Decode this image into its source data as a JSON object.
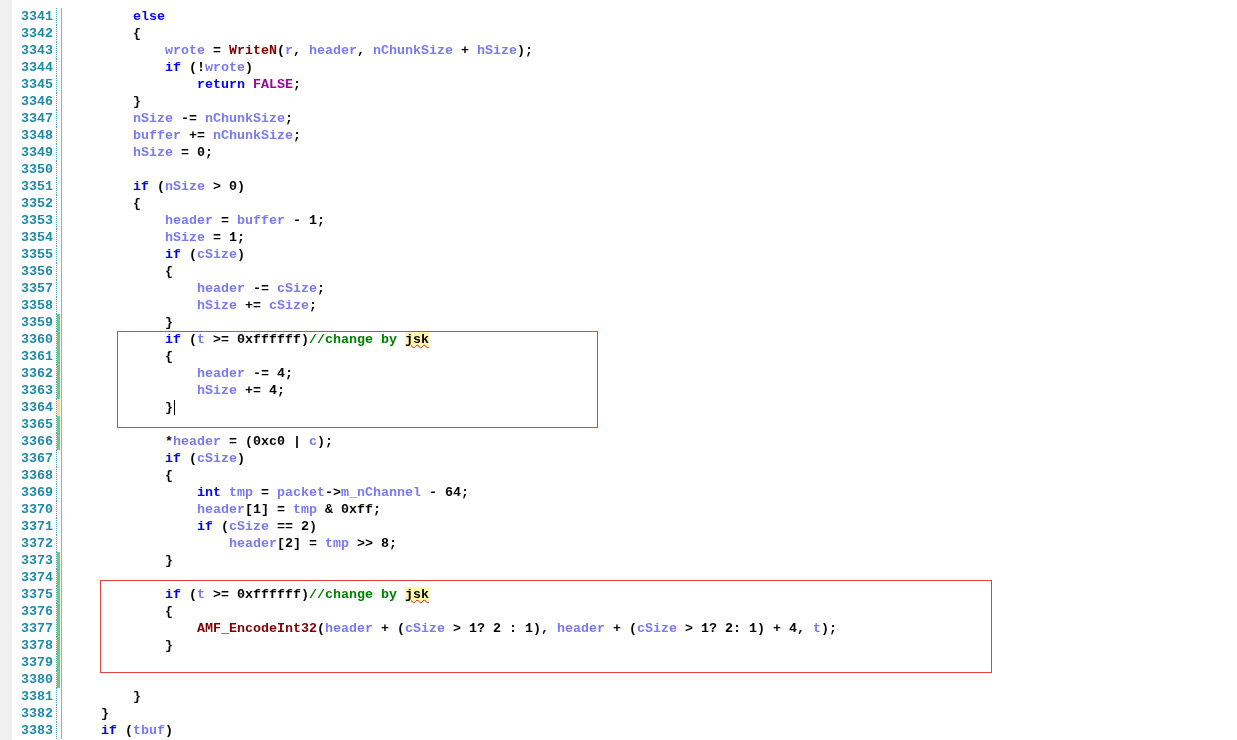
{
  "lines": [
    {
      "kind": "code",
      "number": "3341",
      "modified": false,
      "tokens": [
        {
          "kind": "keyword",
          "text": "        else"
        }
      ]
    },
    {
      "kind": "code",
      "number": "3342",
      "modified": false,
      "tokens": [
        {
          "kind": "plain",
          "text": "        {"
        }
      ]
    },
    {
      "kind": "code",
      "number": "3343",
      "modified": false,
      "tokens": [
        {
          "kind": "variable",
          "text": "            wrote"
        },
        {
          "kind": "plain",
          "text": " = "
        },
        {
          "kind": "function",
          "text": "WriteN"
        },
        {
          "kind": "plain",
          "text": "("
        },
        {
          "kind": "variable",
          "text": "r"
        },
        {
          "kind": "plain",
          "text": ", "
        },
        {
          "kind": "variable",
          "text": "header"
        },
        {
          "kind": "plain",
          "text": ", "
        },
        {
          "kind": "variable",
          "text": "nChunkSize"
        },
        {
          "kind": "plain",
          "text": " + "
        },
        {
          "kind": "variable",
          "text": "hSize"
        },
        {
          "kind": "plain",
          "text": ");"
        }
      ]
    },
    {
      "kind": "code",
      "number": "3344",
      "modified": false,
      "tokens": [
        {
          "kind": "keyword",
          "text": "            if"
        },
        {
          "kind": "plain",
          "text": " (!"
        },
        {
          "kind": "variable",
          "text": "wrote"
        },
        {
          "kind": "plain",
          "text": ")"
        }
      ]
    },
    {
      "kind": "code",
      "number": "3345",
      "modified": false,
      "tokens": [
        {
          "kind": "keyword",
          "text": "                return "
        },
        {
          "kind": "constant",
          "text": "FALSE"
        },
        {
          "kind": "plain",
          "text": ";"
        }
      ]
    },
    {
      "kind": "code",
      "number": "3346",
      "modified": false,
      "tokens": [
        {
          "kind": "plain",
          "text": "        }"
        }
      ]
    },
    {
      "kind": "code",
      "number": "3347",
      "modified": false,
      "tokens": [
        {
          "kind": "variable",
          "text": "        nSize"
        },
        {
          "kind": "plain",
          "text": " -= "
        },
        {
          "kind": "variable",
          "text": "nChunkSize"
        },
        {
          "kind": "plain",
          "text": ";"
        }
      ]
    },
    {
      "kind": "code",
      "number": "3348",
      "modified": false,
      "tokens": [
        {
          "kind": "variable",
          "text": "        buffer"
        },
        {
          "kind": "plain",
          "text": " += "
        },
        {
          "kind": "variable",
          "text": "nChunkSize"
        },
        {
          "kind": "plain",
          "text": ";"
        }
      ]
    },
    {
      "kind": "code",
      "number": "3349",
      "modified": false,
      "tokens": [
        {
          "kind": "variable",
          "text": "        hSize"
        },
        {
          "kind": "plain",
          "text": " = 0;"
        }
      ]
    },
    {
      "kind": "code",
      "number": "3350",
      "modified": false
    },
    {
      "kind": "code",
      "number": "3351",
      "modified": false,
      "tokens": [
        {
          "kind": "keyword",
          "text": "        if"
        },
        {
          "kind": "plain",
          "text": " ("
        },
        {
          "kind": "variable",
          "text": "nSize"
        },
        {
          "kind": "plain",
          "text": " > 0)"
        }
      ]
    },
    {
      "kind": "code",
      "number": "3352",
      "modified": false,
      "tokens": [
        {
          "kind": "plain",
          "text": "        {"
        }
      ]
    },
    {
      "kind": "code",
      "number": "3353",
      "modified": false,
      "tokens": [
        {
          "kind": "variable",
          "text": "            header"
        },
        {
          "kind": "plain",
          "text": " = "
        },
        {
          "kind": "variable",
          "text": "buffer"
        },
        {
          "kind": "plain",
          "text": " - 1;"
        }
      ]
    },
    {
      "kind": "code",
      "number": "3354",
      "modified": false,
      "tokens": [
        {
          "kind": "variable",
          "text": "            hSize"
        },
        {
          "kind": "plain",
          "text": " = 1;"
        }
      ]
    },
    {
      "kind": "code",
      "number": "3355",
      "modified": false,
      "tokens": [
        {
          "kind": "keyword",
          "text": "            if"
        },
        {
          "kind": "plain",
          "text": " ("
        },
        {
          "kind": "variable",
          "text": "cSize"
        },
        {
          "kind": "plain",
          "text": ")"
        }
      ]
    },
    {
      "kind": "code",
      "number": "3356",
      "modified": false,
      "tokens": [
        {
          "kind": "plain",
          "text": "            {"
        }
      ]
    },
    {
      "kind": "code",
      "number": "3357",
      "modified": false,
      "tokens": [
        {
          "kind": "variable",
          "text": "                header"
        },
        {
          "kind": "plain",
          "text": " -= "
        },
        {
          "kind": "variable",
          "text": "cSize"
        },
        {
          "kind": "plain",
          "text": ";"
        }
      ]
    },
    {
      "kind": "code",
      "number": "3358",
      "modified": false,
      "tokens": [
        {
          "kind": "variable",
          "text": "                hSize"
        },
        {
          "kind": "plain",
          "text": " += "
        },
        {
          "kind": "variable",
          "text": "cSize"
        },
        {
          "kind": "plain",
          "text": ";"
        }
      ]
    },
    {
      "kind": "code",
      "number": "3359",
      "modified": true,
      "saved": true,
      "tokens": [
        {
          "kind": "plain",
          "text": "            }"
        }
      ]
    },
    {
      "kind": "annotated_group",
      "lines": [
        {
          "kind": "code",
          "number": "3360",
          "modified": true,
          "saved": true,
          "tokens": [
            {
              "kind": "keyword",
              "text": "            if"
            },
            {
              "kind": "plain",
              "text": " ("
            },
            {
              "kind": "variable",
              "text": "t"
            },
            {
              "kind": "plain",
              "text": " >= 0xffffff)"
            },
            {
              "kind": "comment",
              "text": "//change by "
            },
            {
              "kind": "flagged",
              "text": "jsk"
            }
          ]
        },
        {
          "kind": "code",
          "number": "3361",
          "modified": true,
          "saved": true,
          "tokens": [
            {
              "kind": "plain",
              "text": "            {"
            }
          ]
        },
        {
          "kind": "code",
          "number": "3362",
          "modified": true,
          "saved": true,
          "tokens": [
            {
              "kind": "variable",
              "text": "                header"
            },
            {
              "kind": "plain",
              "text": " -= 4;"
            }
          ]
        },
        {
          "kind": "code",
          "number": "3363",
          "modified": true,
          "saved": true,
          "tokens": [
            {
              "kind": "variable",
              "text": "                hSize"
            },
            {
              "kind": "plain",
              "text": " += 4;"
            }
          ]
        },
        {
          "kind": "code",
          "number": "3364",
          "modified": true,
          "saved": false,
          "caret": true,
          "tokens": [
            {
              "kind": "plain",
              "text": "            }"
            }
          ]
        },
        {
          "kind": "code",
          "number": "3365",
          "modified": true,
          "saved": true
        }
      ]
    },
    {
      "kind": "code",
      "number": "3366",
      "modified": true,
      "saved": true,
      "tokens": [
        {
          "kind": "plain",
          "text": "            *"
        },
        {
          "kind": "variable",
          "text": "header"
        },
        {
          "kind": "plain",
          "text": " = (0xc0 | "
        },
        {
          "kind": "variable",
          "text": "c"
        },
        {
          "kind": "plain",
          "text": ");"
        }
      ]
    },
    {
      "kind": "code",
      "number": "3367",
      "modified": false,
      "tokens": [
        {
          "kind": "keyword",
          "text": "            if"
        },
        {
          "kind": "plain",
          "text": " ("
        },
        {
          "kind": "variable",
          "text": "cSize"
        },
        {
          "kind": "plain",
          "text": ")"
        }
      ]
    },
    {
      "kind": "code",
      "number": "3368",
      "modified": false,
      "tokens": [
        {
          "kind": "plain",
          "text": "            {"
        }
      ]
    },
    {
      "kind": "code",
      "number": "3369",
      "modified": false,
      "tokens": [
        {
          "kind": "keyword",
          "text": "                int "
        },
        {
          "kind": "variable",
          "text": "tmp"
        },
        {
          "kind": "plain",
          "text": " = "
        },
        {
          "kind": "variable",
          "text": "packet"
        },
        {
          "kind": "plain",
          "text": "->"
        },
        {
          "kind": "variable",
          "text": "m_nChannel"
        },
        {
          "kind": "plain",
          "text": " - 64;"
        }
      ]
    },
    {
      "kind": "code",
      "number": "3370",
      "modified": false,
      "tokens": [
        {
          "kind": "variable",
          "text": "                header"
        },
        {
          "kind": "plain",
          "text": "[1] = "
        },
        {
          "kind": "variable",
          "text": "tmp"
        },
        {
          "kind": "plain",
          "text": " & 0xff;"
        }
      ]
    },
    {
      "kind": "code",
      "number": "3371",
      "modified": false,
      "tokens": [
        {
          "kind": "keyword",
          "text": "                if"
        },
        {
          "kind": "plain",
          "text": " ("
        },
        {
          "kind": "variable",
          "text": "cSize"
        },
        {
          "kind": "plain",
          "text": " == 2)"
        }
      ]
    },
    {
      "kind": "code",
      "number": "3372",
      "modified": false,
      "tokens": [
        {
          "kind": "variable",
          "text": "                    header"
        },
        {
          "kind": "plain",
          "text": "[2] = "
        },
        {
          "kind": "variable",
          "text": "tmp"
        },
        {
          "kind": "plain",
          "text": " >> 8;"
        }
      ]
    },
    {
      "kind": "code",
      "number": "3373",
      "modified": true,
      "saved": true,
      "tokens": [
        {
          "kind": "plain",
          "text": "            }"
        }
      ]
    },
    {
      "kind": "code",
      "number": "3374",
      "modified": true,
      "saved": true
    },
    {
      "kind": "annotated_group",
      "lines": [
        {
          "kind": "code",
          "number": "3375",
          "modified": true,
          "saved": true,
          "tokens": [
            {
              "kind": "keyword",
              "text": "            if"
            },
            {
              "kind": "plain",
              "text": " ("
            },
            {
              "kind": "variable",
              "text": "t"
            },
            {
              "kind": "plain",
              "text": " >= 0xffffff)"
            },
            {
              "kind": "comment",
              "text": "//change by "
            },
            {
              "kind": "flagged",
              "text": "jsk"
            }
          ]
        },
        {
          "kind": "code",
          "number": "3376",
          "modified": true,
          "saved": true,
          "tokens": [
            {
              "kind": "plain",
              "text": "            {"
            }
          ]
        },
        {
          "kind": "code",
          "number": "3377",
          "modified": true,
          "saved": true,
          "tokens": [
            {
              "kind": "function",
              "text": "                AMF_EncodeInt32"
            },
            {
              "kind": "plain",
              "text": "("
            },
            {
              "kind": "variable",
              "text": "header"
            },
            {
              "kind": "plain",
              "text": " + ("
            },
            {
              "kind": "variable",
              "text": "cSize"
            },
            {
              "kind": "plain",
              "text": " > 1? 2 : 1), "
            },
            {
              "kind": "variable",
              "text": "header"
            },
            {
              "kind": "plain",
              "text": " + ("
            },
            {
              "kind": "variable",
              "text": "cSize"
            },
            {
              "kind": "plain",
              "text": " > 1? 2: 1) + 4, "
            },
            {
              "kind": "variable",
              "text": "t"
            },
            {
              "kind": "plain",
              "text": ");"
            }
          ]
        },
        {
          "kind": "code",
          "number": "3378",
          "modified": true,
          "saved": true,
          "tokens": [
            {
              "kind": "plain",
              "text": "            }"
            }
          ]
        },
        {
          "kind": "code",
          "number": "3379",
          "modified": true,
          "saved": true
        }
      ]
    },
    {
      "kind": "code",
      "number": "3380",
      "modified": true,
      "saved": true
    },
    {
      "kind": "code",
      "number": "3381",
      "modified": false,
      "tokens": [
        {
          "kind": "plain",
          "text": "        }"
        }
      ]
    },
    {
      "kind": "code",
      "number": "3382",
      "modified": false,
      "tokens": [
        {
          "kind": "plain",
          "text": "    }"
        }
      ]
    },
    {
      "kind": "code",
      "number": "3383",
      "modified": false,
      "tokens": [
        {
          "kind": "keyword",
          "text": "    if"
        },
        {
          "kind": "plain",
          "text": " ("
        },
        {
          "kind": "variable",
          "text": "tbuf"
        },
        {
          "kind": "plain",
          "text": ")"
        }
      ]
    }
  ]
}
